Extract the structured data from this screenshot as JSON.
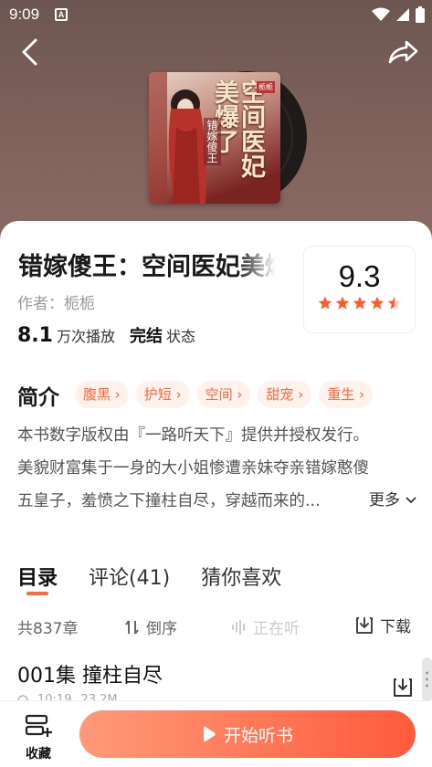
{
  "status_bar": {
    "time": "9:09",
    "notification_badge": "A"
  },
  "book": {
    "title": "错嫁傻王：空间医妃美爆了",
    "author_label": "作者：",
    "author": "栀栀",
    "play_count": "8.1",
    "play_unit": "万次播放",
    "status_value": "完结",
    "status_label": "状态",
    "score": "9.3",
    "star_rating": 4.5,
    "cover_art": {
      "title_chars": "空间医妃美爆了",
      "sub_chars": "错嫁傻王",
      "author_stamp": "栀栀"
    }
  },
  "intro": {
    "label": "简介",
    "tags": [
      "腹黑",
      "护短",
      "空间",
      "甜宠",
      "重生"
    ],
    "line1": "本书数字版权由『一路听天下』提供并授权发行。",
    "line2": "美貌财富集于一身的大小姐惨遭亲妹夺亲错嫁憨傻",
    "line3": "五皇子，羞愤之下撞柱自尽，穿越而来的...",
    "more_label": "更多"
  },
  "tabs": [
    {
      "label": "目录"
    },
    {
      "label": "评论(41)"
    },
    {
      "label": "猜你喜欢"
    }
  ],
  "catalog": {
    "chapter_count": "共837章",
    "sort_label": "倒序",
    "playing_label": "正在听",
    "download_label": "下载",
    "episode": {
      "title": "001集 撞柱自尽",
      "duration": "10:19",
      "size": "23.2M"
    }
  },
  "bottom": {
    "favorite_label": "收藏",
    "start_label": "开始听书"
  },
  "colors": {
    "accent": "#ff6a3d",
    "hero_bg": "#7a5e58",
    "tag_bg": "#fff2ec"
  }
}
